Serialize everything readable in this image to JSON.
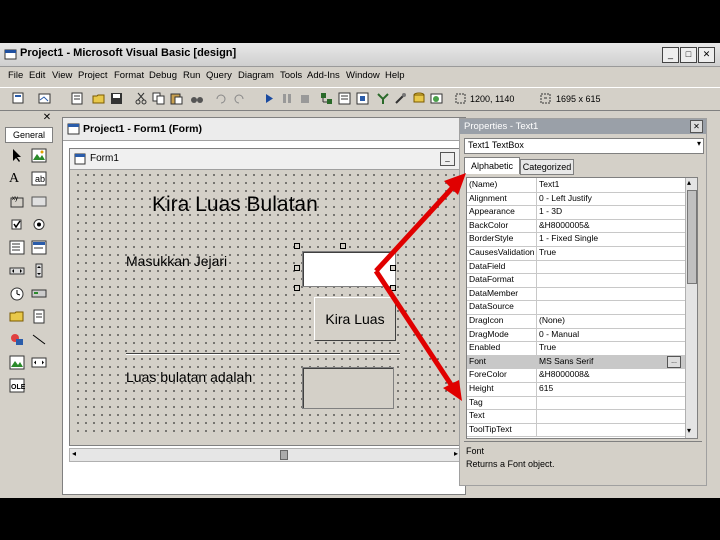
{
  "window": {
    "title": "Project1 - Microsoft Visual Basic [design]"
  },
  "menu": [
    "File",
    "Edit",
    "View",
    "Project",
    "Format",
    "Debug",
    "Run",
    "Query",
    "Diagram",
    "Tools",
    "Add-Ins",
    "Window",
    "Help"
  ],
  "toolbar": {
    "position": "1200, 1140",
    "size": "1695 x 615"
  },
  "toolbox": {
    "title": "General"
  },
  "project_window": {
    "title": "Project1 - Form1 (Form)"
  },
  "form": {
    "caption": "Form1",
    "heading": "Kira Luas Bulatan",
    "label_input": "Masukkan Jejari",
    "button": "Kira Luas",
    "label_result": "Luas bulatan adalah"
  },
  "properties": {
    "title": "Properties - Text1",
    "object": "Text1  TextBox",
    "tabs": [
      "Alphabetic",
      "Categorized"
    ],
    "rows": [
      {
        "name": "(Name)",
        "value": "Text1"
      },
      {
        "name": "Alignment",
        "value": "0 - Left Justify"
      },
      {
        "name": "Appearance",
        "value": "1 - 3D"
      },
      {
        "name": "BackColor",
        "value": "&H8000005&"
      },
      {
        "name": "BorderStyle",
        "value": "1 - Fixed Single"
      },
      {
        "name": "CausesValidation",
        "value": "True"
      },
      {
        "name": "DataField",
        "value": ""
      },
      {
        "name": "DataFormat",
        "value": ""
      },
      {
        "name": "DataMember",
        "value": ""
      },
      {
        "name": "DataSource",
        "value": ""
      },
      {
        "name": "DragIcon",
        "value": "(None)"
      },
      {
        "name": "DragMode",
        "value": "0 - Manual"
      },
      {
        "name": "Enabled",
        "value": "True"
      },
      {
        "name": "Font",
        "value": "MS Sans Serif"
      },
      {
        "name": "ForeColor",
        "value": "&H8000008&"
      },
      {
        "name": "Height",
        "value": "615"
      },
      {
        "name": "Tag",
        "value": ""
      },
      {
        "name": "Text",
        "value": ""
      },
      {
        "name": "ToolTipText",
        "value": ""
      }
    ],
    "desc_title": "Font",
    "desc_text": "Returns a Font object."
  },
  "colors": {
    "annotation_arrow": "#e00000",
    "selected_row": "#c8c8c8"
  }
}
